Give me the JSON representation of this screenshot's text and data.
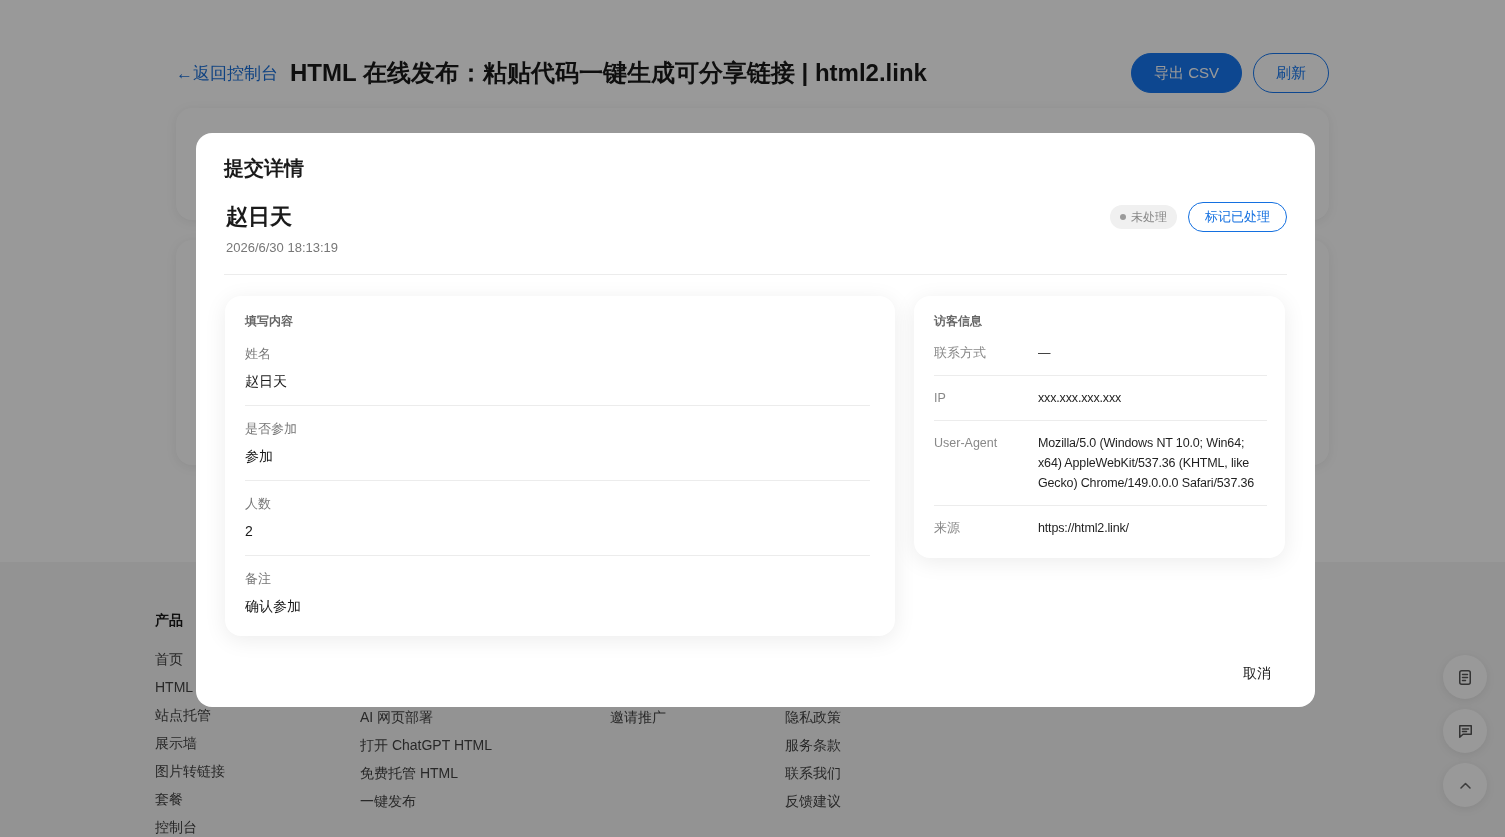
{
  "page": {
    "back_link": "←返回控制台",
    "title": "HTML 在线发布：粘贴代码一键生成可分享链接 | html2.link",
    "buttons": [
      {
        "label": "导出 CSV",
        "kind": "primary"
      },
      {
        "label": "刷新",
        "kind": "outline"
      }
    ]
  },
  "footer": {
    "columns": [
      {
        "heading": "产品",
        "links": [
          "首页",
          "HTML",
          "站点托管",
          "展示墙",
          "图片转链接",
          "套餐",
          "控制台"
        ]
      },
      {
        "links": [
          "AI 网页部署",
          "打开 ChatGPT HTML",
          "免费托管 HTML",
          "一键发布"
        ]
      },
      {
        "links": [
          "邀请推广"
        ]
      },
      {
        "links": [
          "隐私政策",
          "服务条款",
          "联系我们",
          "反馈建议"
        ]
      }
    ]
  },
  "dialog": {
    "title": "提交详情",
    "submitter": {
      "name": "赵日天",
      "time": "2026/6/30 18:13:19"
    },
    "status": {
      "label": "未处理",
      "processed": false
    },
    "mark_button": "标记已处理",
    "form_card": {
      "title": "填写内容",
      "fields": [
        {
          "label": "姓名",
          "value": "赵日天"
        },
        {
          "label": "是否参加",
          "value": "参加"
        },
        {
          "label": "人数",
          "value": "2"
        },
        {
          "label": "备注",
          "value": "确认参加"
        }
      ]
    },
    "visitor_card": {
      "title": "访客信息",
      "rows": [
        {
          "label": "联系方式",
          "value": "—"
        },
        {
          "label": "IP",
          "value": "xxx.xxx.xxx.xxx"
        },
        {
          "label": "User-Agent",
          "value": "Mozilla/5.0 (Windows NT 10.0; Win64; x64) AppleWebKit/537.36 (KHTML, like Gecko) Chrome/149.0.0.0 Safari/537.36"
        },
        {
          "label": "来源",
          "value": "https://html2.link/"
        }
      ]
    },
    "cancel_button": "取消"
  }
}
